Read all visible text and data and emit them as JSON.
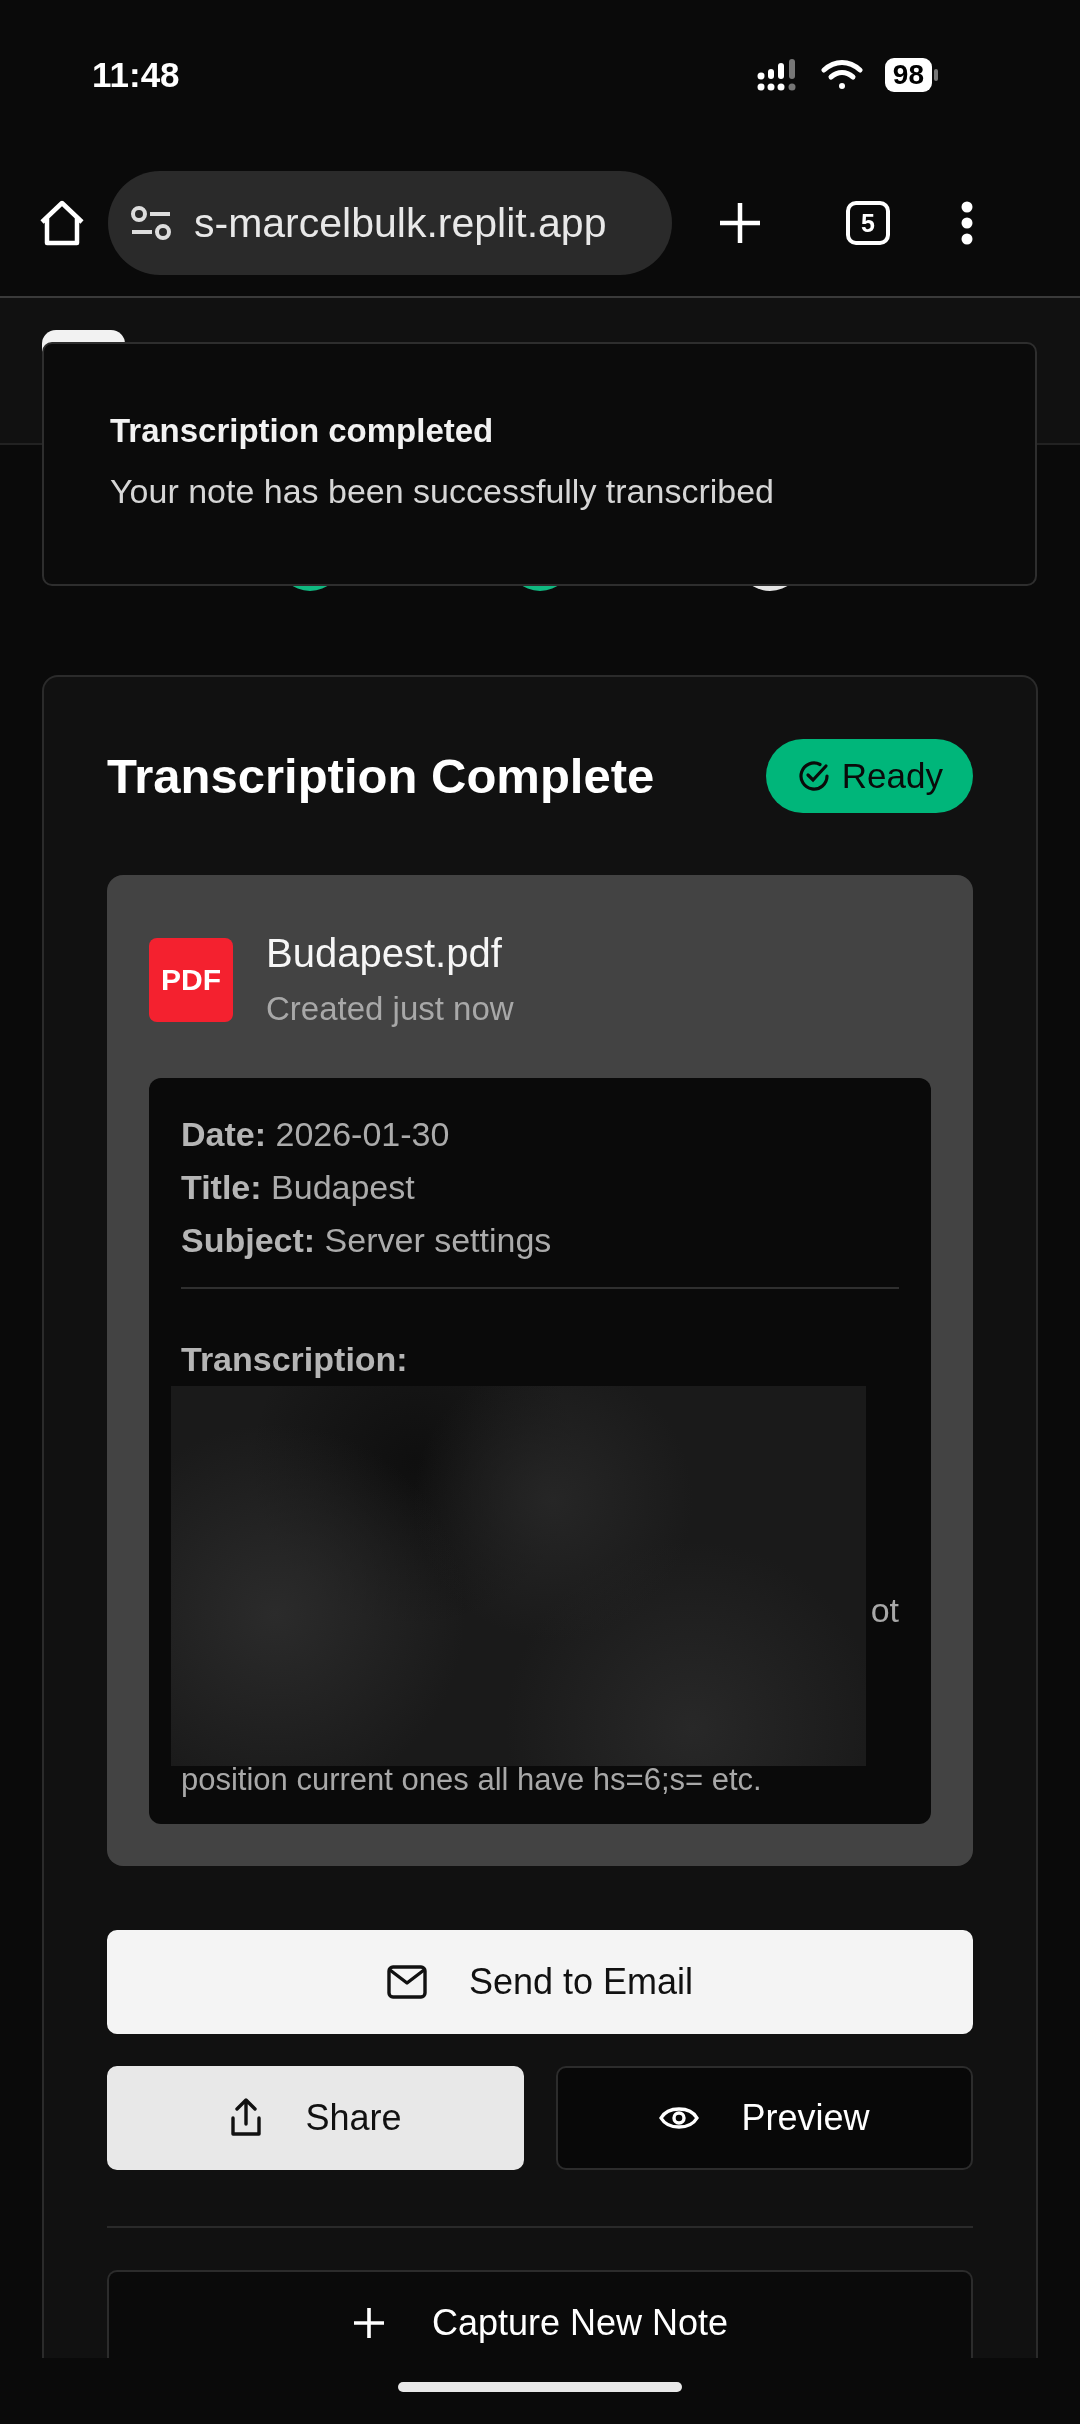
{
  "status_bar": {
    "time": "11:48",
    "battery": "98"
  },
  "browser": {
    "url": "s-marcelbulk.replit.app",
    "tab_count": "5"
  },
  "progress_steps": [
    {
      "color": "#10b981"
    },
    {
      "color": "#10b981"
    },
    {
      "color": "#e5e5e5"
    }
  ],
  "toast": {
    "title": "Transcription completed",
    "message": "Your note has been successfully transcribed"
  },
  "result": {
    "title": "Transcription Complete",
    "badge": "Ready",
    "file": {
      "type_label": "PDF",
      "name": "Budapest.pdf",
      "created": "Created just now"
    },
    "fields": [
      {
        "label": "Date:",
        "value": "2026-01-30"
      },
      {
        "label": "Title:",
        "value": "Budapest"
      },
      {
        "label": "Subject:",
        "value": "Server settings"
      }
    ],
    "transcription_label": "Transcription:",
    "transcription_fragments": [
      "ot",
      "position current ones all have hs=6;s= etc."
    ]
  },
  "actions": [
    {
      "label": "Send to Email"
    },
    {
      "label": "Share"
    },
    {
      "label": "Preview"
    }
  ],
  "new_note": {
    "label": "Capture New Note"
  }
}
